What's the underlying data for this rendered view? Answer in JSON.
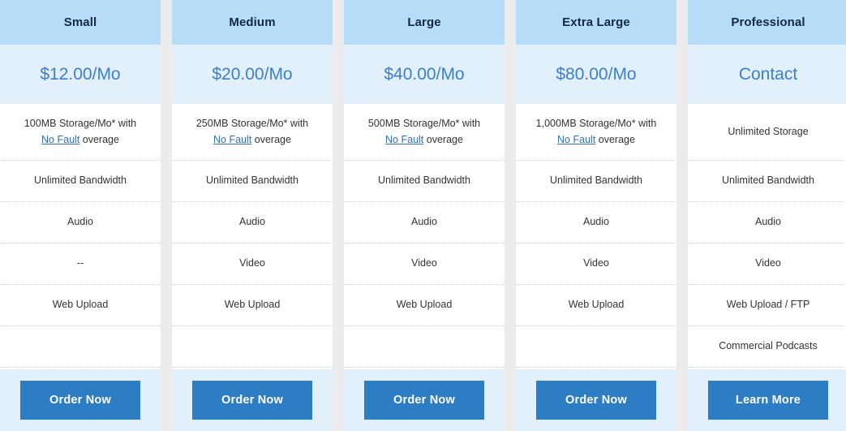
{
  "table": {
    "feature_row_count": 6,
    "columns": [
      {
        "name": "Small",
        "price": "$12.00/Mo",
        "storage_prefix": "100MB Storage/Mo* with",
        "storage_link": "No Fault",
        "storage_suffix": " overage",
        "features": [
          "Unlimited Bandwidth",
          "Audio",
          "--",
          "Web Upload",
          ""
        ],
        "cta": "Order Now"
      },
      {
        "name": "Medium",
        "price": "$20.00/Mo",
        "storage_prefix": "250MB Storage/Mo* with",
        "storage_link": "No Fault",
        "storage_suffix": " overage",
        "features": [
          "Unlimited Bandwidth",
          "Audio",
          "Video",
          "Web Upload",
          ""
        ],
        "cta": "Order Now"
      },
      {
        "name": "Large",
        "price": "$40.00/Mo",
        "storage_prefix": "500MB Storage/Mo* with",
        "storage_link": "No Fault",
        "storage_suffix": " overage",
        "features": [
          "Unlimited Bandwidth",
          "Audio",
          "Video",
          "Web Upload",
          ""
        ],
        "cta": "Order Now"
      },
      {
        "name": "Extra Large",
        "price": "$80.00/Mo",
        "storage_prefix": "1,000MB Storage/Mo* with",
        "storage_link": "No Fault",
        "storage_suffix": " overage",
        "features": [
          "Unlimited Bandwidth",
          "Audio",
          "Video",
          "Web Upload",
          ""
        ],
        "cta": "Order Now"
      },
      {
        "name": "Professional",
        "price": "Contact",
        "storage_prefix": "Unlimited Storage",
        "storage_link": "",
        "storage_suffix": "",
        "features": [
          "Unlimited Bandwidth",
          "Audio",
          "Video",
          "Web Upload / FTP",
          "Commercial Podcasts"
        ],
        "cta": "Learn More"
      }
    ]
  },
  "colors": {
    "header_bg": "#b7dcf8",
    "price_bg": "#e2f0fc",
    "price_text": "#3b7fd4",
    "button_bg": "#2d7dc4",
    "button_text": "#ffffff",
    "page_bg": "#ececec",
    "row_divider": "#d4d4d4",
    "link": "#2f6fc4",
    "header_text": "#102a43",
    "feature_text": "#333333"
  }
}
